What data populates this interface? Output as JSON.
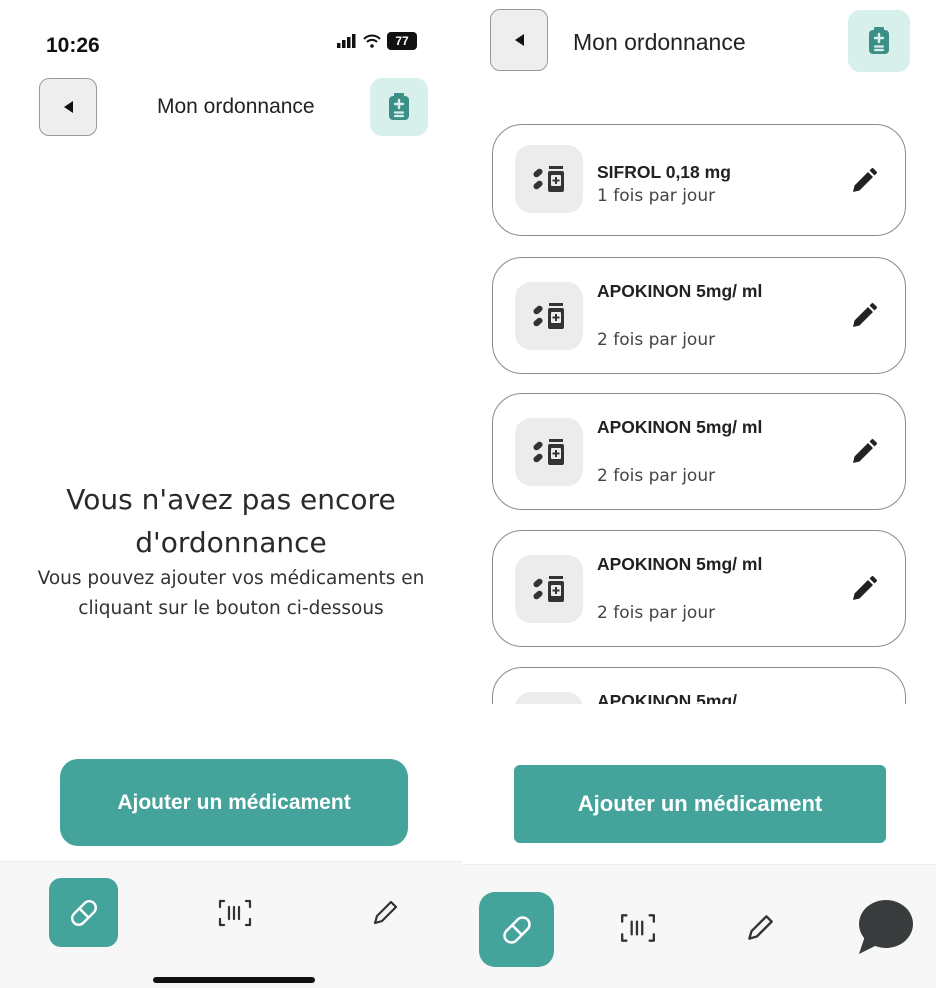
{
  "status_bar": {
    "time": "10:26",
    "battery": "77"
  },
  "header": {
    "title": "Mon ordonnance"
  },
  "empty_state": {
    "title": "Vous n'avez pas encore d'ordonnance",
    "description": "Vous pouvez ajouter vos médicaments en cliquant sur le bouton ci-dessous"
  },
  "add_button_label": "Ajouter un médicament",
  "medications": [
    {
      "name": "SIFROL 0,18 mg",
      "frequency": "1 fois par jour"
    },
    {
      "name": "APOKINON 5mg/ ml",
      "frequency": "2 fois par jour"
    },
    {
      "name": "APOKINON 5mg/ ml",
      "frequency": "2 fois par jour"
    },
    {
      "name": "APOKINON 5mg/ ml",
      "frequency": "2 fois par jour"
    },
    {
      "name": "APOKINON 5mg/",
      "frequency": ""
    }
  ],
  "nav": {
    "items": [
      {
        "icon": "pill-icon",
        "active": true
      },
      {
        "icon": "barcode-scan-icon",
        "active": false
      },
      {
        "icon": "pencil-icon",
        "active": false
      },
      {
        "icon": "chat-bubble-icon",
        "active": false
      }
    ]
  },
  "colors": {
    "accent": "#44a39b",
    "accent_light": "#d7f0ec"
  }
}
